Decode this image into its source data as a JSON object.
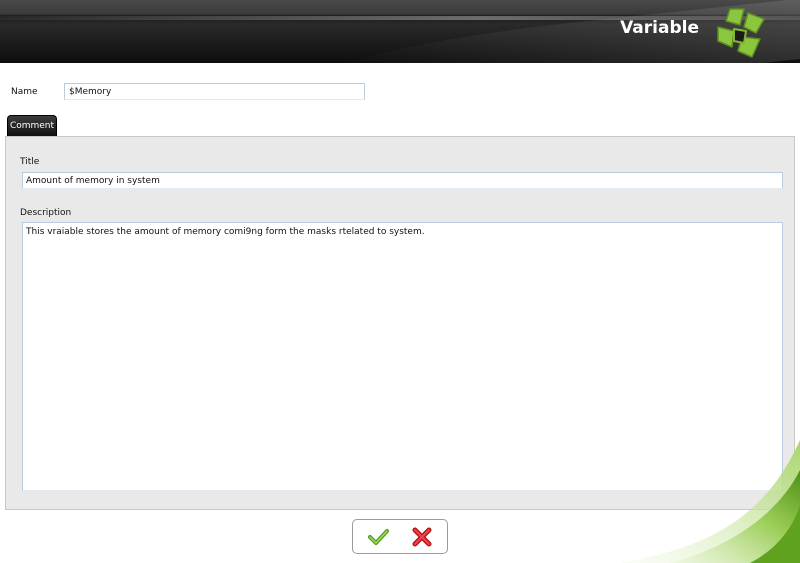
{
  "header": {
    "title": "Variable",
    "logo_icon": "green-clover-logo-icon"
  },
  "form": {
    "name_label": "Name",
    "name_value": "$Memory",
    "tabs": [
      {
        "label": "Comment",
        "active": true
      }
    ],
    "title_label": "Title",
    "title_value": "Amount of memory in system",
    "description_label": "Description",
    "description_value": "This vraiable stores the amount of memory comi9ng form the masks rtelated to system."
  },
  "actions": {
    "ok_icon": "green-check-icon",
    "cancel_icon": "red-x-icon"
  },
  "colors": {
    "header_bg": "#1a1a1a",
    "accent_green": "#7fb832",
    "panel_bg": "#e9e9e9",
    "input_border": "#b9cce0",
    "cancel_red": "#d8262c"
  }
}
